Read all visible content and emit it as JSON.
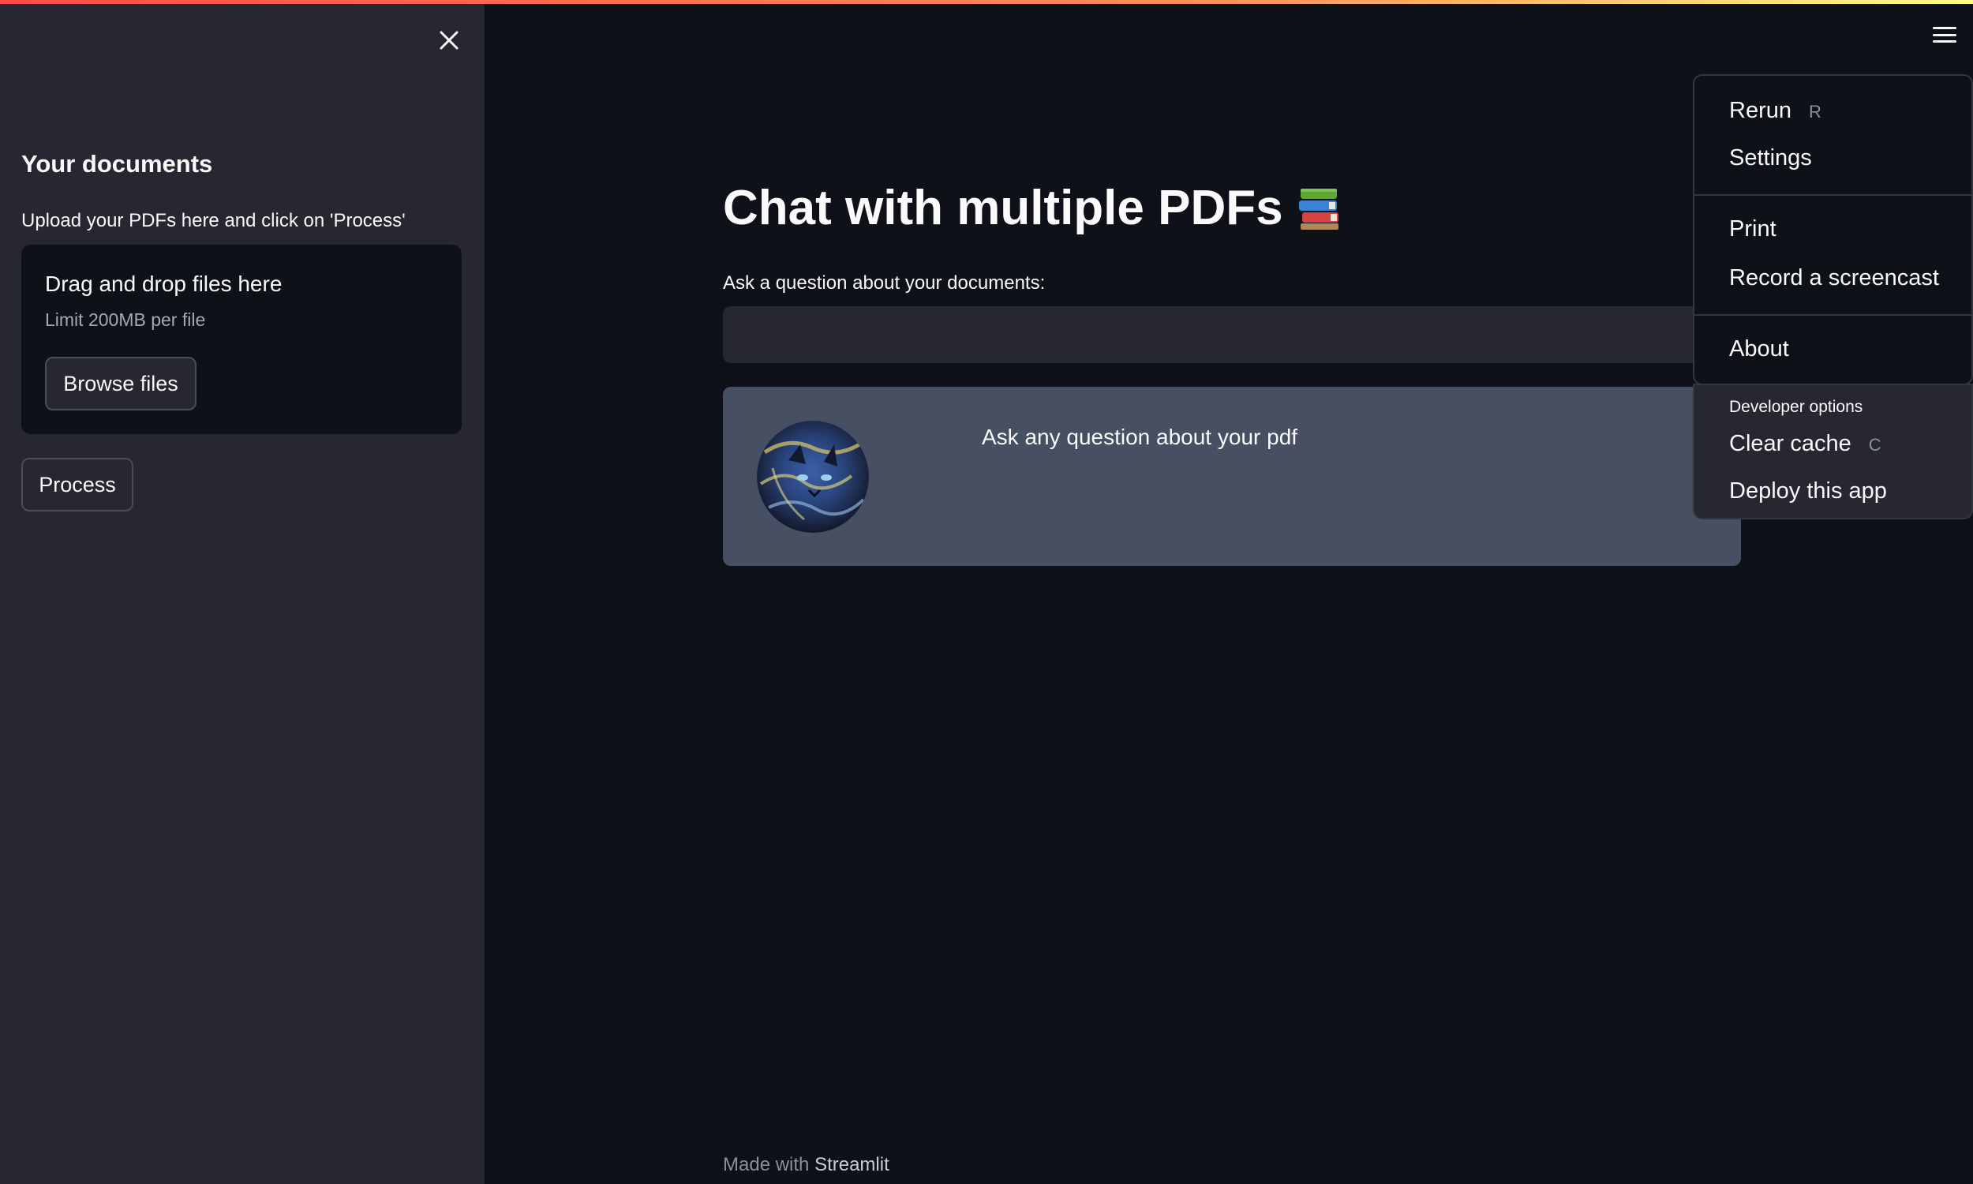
{
  "sidebar": {
    "heading": "Your documents",
    "upload_label": "Upload your PDFs here and click on 'Process'",
    "uploader": {
      "title": "Drag and drop files here",
      "limit": "Limit 200MB per file",
      "browse_label": "Browse files"
    },
    "process_label": "Process"
  },
  "main": {
    "title": "Chat with multiple PDFs",
    "title_icon": "books-icon",
    "question_label": "Ask a question about your documents:",
    "question_value": "",
    "bot_message": "Ask any question about your pdf"
  },
  "footer": {
    "made_with": "Made with",
    "brand": "Streamlit"
  },
  "menu": {
    "items": [
      {
        "label": "Rerun",
        "shortcut": "R"
      },
      {
        "label": "Settings"
      },
      {
        "label": "Print"
      },
      {
        "label": "Record a screencast"
      },
      {
        "label": "About"
      }
    ],
    "developer": {
      "title": "Developer options",
      "items": [
        {
          "label": "Clear cache",
          "shortcut": "C"
        },
        {
          "label": "Deploy this app"
        }
      ]
    }
  },
  "colors": {
    "background": "#0e1117",
    "sidebar": "#262730",
    "bot_message_bg": "#475063",
    "accent": "#ff4b4b"
  }
}
